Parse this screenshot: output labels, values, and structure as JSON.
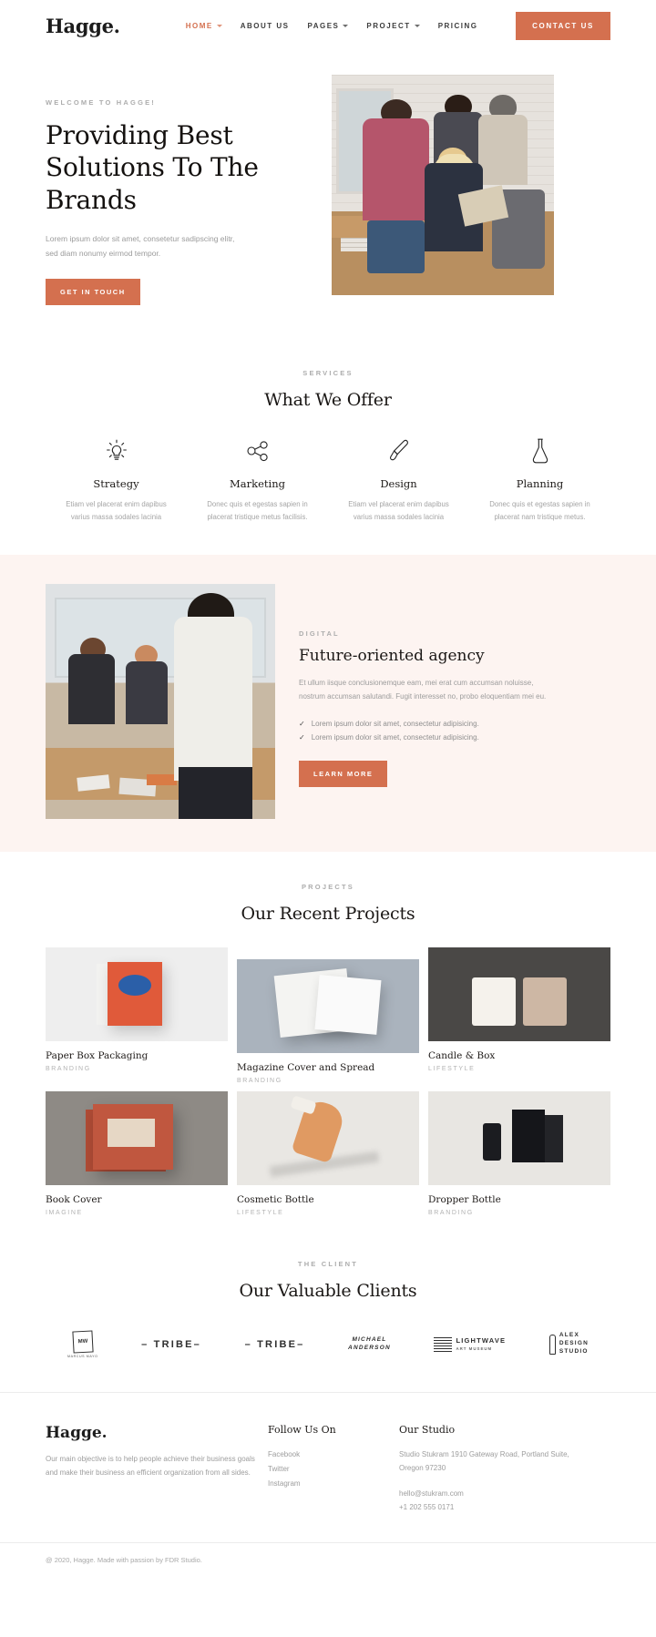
{
  "header": {
    "brand": "Hagge.",
    "nav": [
      {
        "label": "HOME",
        "caret": true,
        "active": true
      },
      {
        "label": "ABOUT US",
        "caret": false,
        "active": false
      },
      {
        "label": "PAGES",
        "caret": true,
        "active": false
      },
      {
        "label": "PROJECT",
        "caret": true,
        "active": false
      },
      {
        "label": "PRICING",
        "caret": false,
        "active": false
      }
    ],
    "cta_label": "CONTACT US",
    "accent": "#d4704f"
  },
  "hero": {
    "eyebrow": "WELCOME TO HAGGE!",
    "title": "Providing Best Solutions To The Brands",
    "description": "Lorem ipsum dolor sit amet, consetetur sadipscing elitr, sed diam nonumy eirmod tempor.",
    "button_label": "GET IN TOUCH"
  },
  "services": {
    "eyebrow": "SERVICES",
    "title": "What We Offer",
    "items": [
      {
        "icon": "lightbulb-icon",
        "title": "Strategy",
        "text": "Etiam vel placerat enim dapibus varius massa sodales lacinia"
      },
      {
        "icon": "share-nodes-icon",
        "title": "Marketing",
        "text": "Donec quis et egestas sapien in placerat tristique metus facilisis."
      },
      {
        "icon": "paintbrush-icon",
        "title": "Design",
        "text": "Etiam vel placerat enim dapibus varius massa sodales lacinia"
      },
      {
        "icon": "flask-icon",
        "title": "Planning",
        "text": "Donec quis et egestas sapien in placerat nam tristique metus."
      }
    ]
  },
  "about": {
    "eyebrow": "DIGITAL",
    "title": "Future-oriented agency",
    "description": "Et ullum iisque conclusionemque eam, mei erat cum accumsan noluisse, nostrum accumsan salutandi. Fugit interesset no, probo eloquentiam mei eu.",
    "checks": [
      "Lorem ipsum dolor sit amet, consectetur adipisicing.",
      "Lorem ipsum dolor sit amet, consectetur adipisicing."
    ],
    "button_label": "LEARN MORE",
    "background": "#fdf4f1"
  },
  "projects": {
    "eyebrow": "PROJECTS",
    "title": "Our Recent Projects",
    "items": [
      {
        "title": "Paper Box Packaging",
        "category": "BRANDING"
      },
      {
        "title": "Magazine Cover and Spread",
        "category": "BRANDING"
      },
      {
        "title": "Candle & Box",
        "category": "LIFESTYLE"
      },
      {
        "title": "Book Cover",
        "category": "IMAGINE"
      },
      {
        "title": "Cosmetic Bottle",
        "category": "LIFESTYLE"
      },
      {
        "title": "Dropper Bottle",
        "category": "BRANDING"
      }
    ]
  },
  "clients": {
    "eyebrow": "THE CLIENT",
    "title": "Our Valuable Clients",
    "logos": [
      {
        "name": "marcus-mayo-logo",
        "mark": "MW",
        "sub": "MARCUS MAYO"
      },
      {
        "name": "tribe-logo-1",
        "text": "– TRIBE–"
      },
      {
        "name": "tribe-logo-2",
        "text": "– TRIBE–"
      },
      {
        "name": "michael-anderson-logo",
        "line1": "MICHAEL",
        "line2": "ANDERSON"
      },
      {
        "name": "lightwave-art-museum-logo",
        "line1": "LIGHTWAVE",
        "line2": "ART MUSEUM"
      },
      {
        "name": "alex-design-studio-logo",
        "line1": "ALEX",
        "line2": "DESIGN",
        "line3": "STUDIO"
      }
    ]
  },
  "footer": {
    "brand": "Hagge.",
    "about": "Our main objective is to help people achieve their business goals and make their business an efficient organization from all sides.",
    "follow": {
      "heading": "Follow Us On",
      "links": [
        "Facebook",
        "Twitter",
        "Instagram"
      ]
    },
    "studio": {
      "heading": "Our Studio",
      "address": "Studio Stukram 1910 Gateway Road, Portland Suite, Oregon 97230",
      "email": "hello@stukram.com",
      "phone": "+1 202 555 0171"
    },
    "copyright": "@ 2020, Hagge. Made with passion by FDR Studio."
  }
}
